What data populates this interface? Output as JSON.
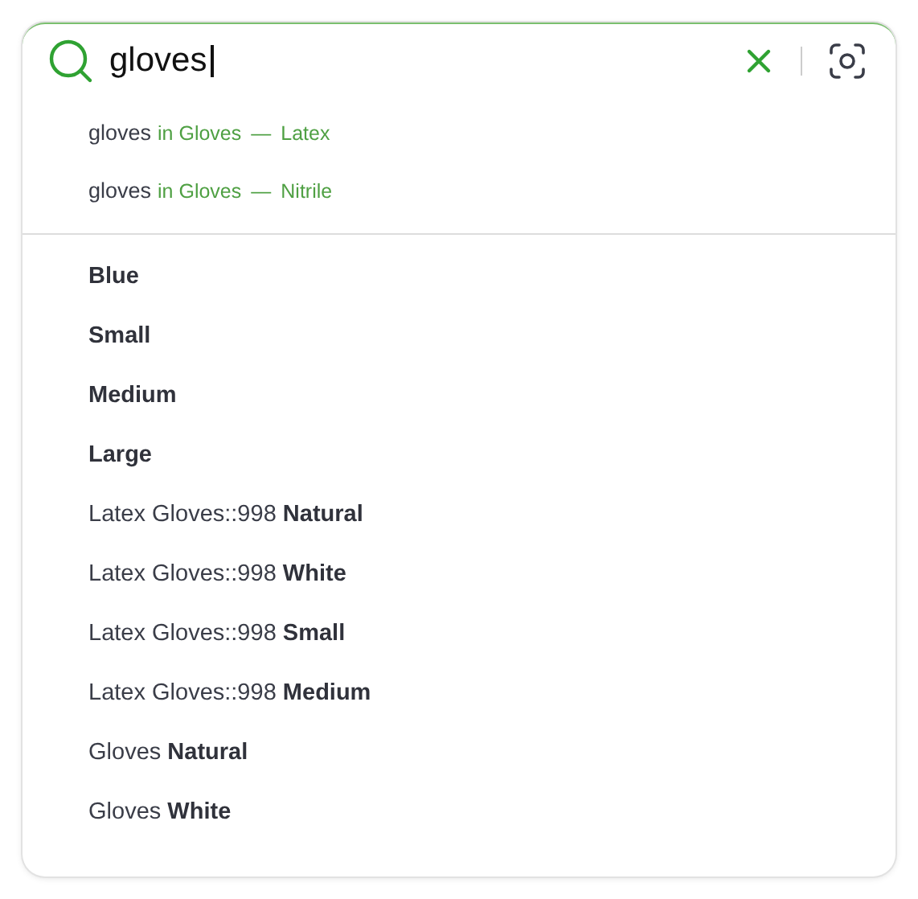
{
  "search": {
    "value": "gloves"
  },
  "scoped_suggestions": [
    {
      "query": "gloves",
      "scope": "in Gloves",
      "separator": "—",
      "category": "Latex"
    },
    {
      "query": "gloves",
      "scope": "in Gloves",
      "separator": "—",
      "category": "Nitrile"
    }
  ],
  "suggestions": [
    "**Blue**",
    "**Small**",
    "**Medium**",
    "**Large**",
    "Latex Gloves::998 **Natural**",
    "Latex Gloves::998 **White**",
    "Latex Gloves::998 **Small**",
    "Latex Gloves::998 **Medium**",
    "Gloves **Natural**",
    "Gloves **White**"
  ]
}
